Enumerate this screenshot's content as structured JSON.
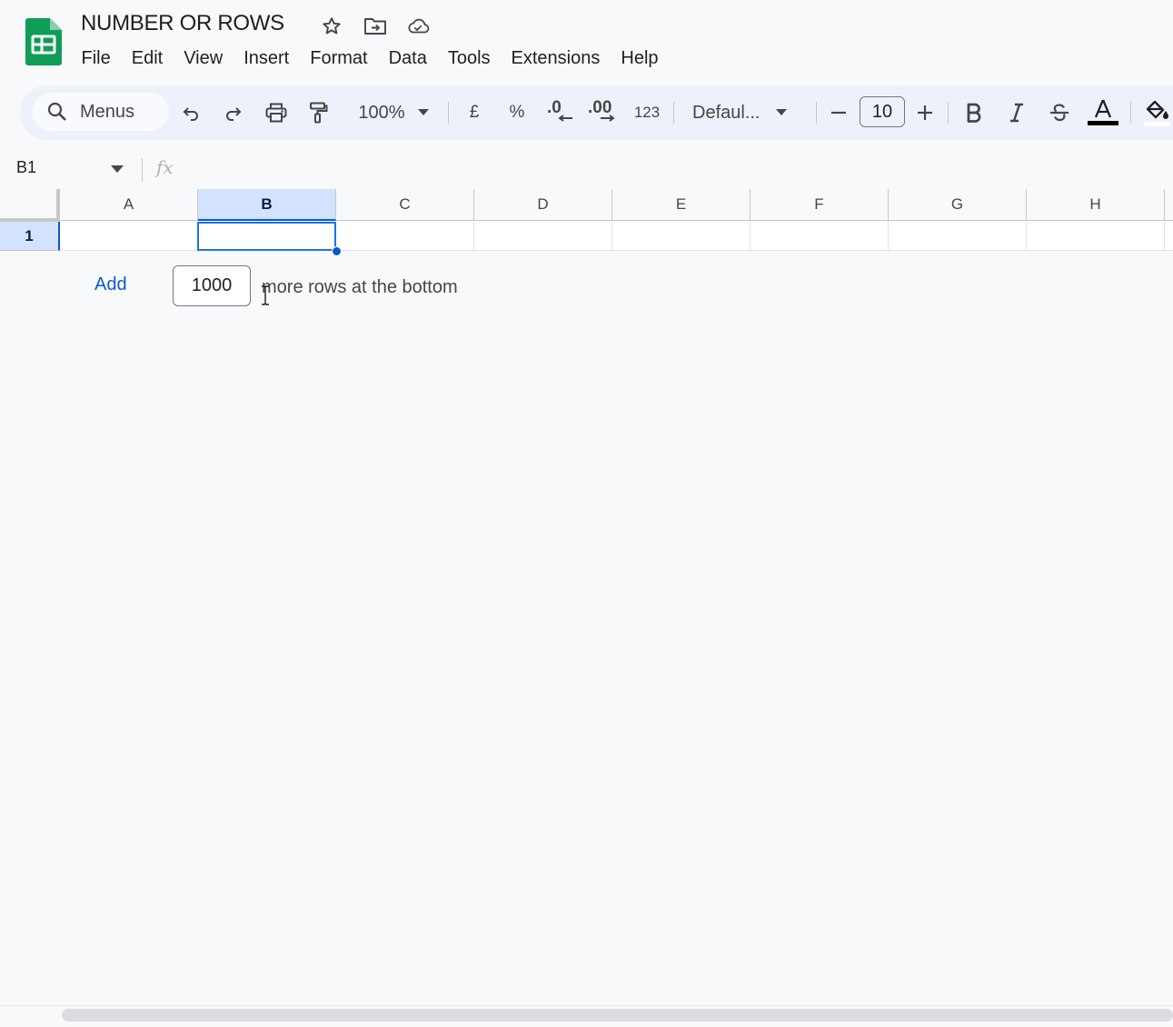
{
  "document": {
    "title": "NUMBER OR ROWS"
  },
  "menubar": {
    "items": [
      "File",
      "Edit",
      "View",
      "Insert",
      "Format",
      "Data",
      "Tools",
      "Extensions",
      "Help"
    ]
  },
  "toolbar": {
    "search_label": "Menus",
    "zoom": "100%",
    "currency": "£",
    "percent": "%",
    "decrease_decimal": ".0",
    "increase_decimal": ".00",
    "number_format": "123",
    "font": "Defaul...",
    "font_size": "10"
  },
  "formula_bar": {
    "name_box": "B1",
    "fx_label": "fx"
  },
  "grid": {
    "columns": [
      "A",
      "B",
      "C",
      "D",
      "E",
      "F",
      "G",
      "H"
    ],
    "active_column": "B",
    "rows": [
      "1"
    ]
  },
  "add_rows": {
    "button_label": "Add",
    "count": "1000",
    "suffix": "more rows at the bottom"
  },
  "colors": {
    "accent": "#0b57d0",
    "selection_bg": "#d3e3fd",
    "sheets_green": "#0f9d58"
  }
}
